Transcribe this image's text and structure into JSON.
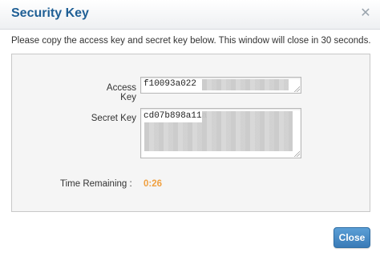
{
  "dialog": {
    "title": "Security Key",
    "close_icon": "close-icon",
    "message": "Please copy the access key and secret key below. This window will close in 30 seconds.",
    "access_key_label": "Access Key",
    "access_key_value": "f10093a022",
    "secret_key_label": "Secret Key",
    "secret_key_value": "cd07b898a11a",
    "time_remaining_label": "Time Remaining :",
    "time_remaining_value": "0:26",
    "close_button": "Close"
  },
  "colors": {
    "title": "#1f5f95",
    "timer": "#f0a040",
    "button": "#3a7bb7"
  }
}
